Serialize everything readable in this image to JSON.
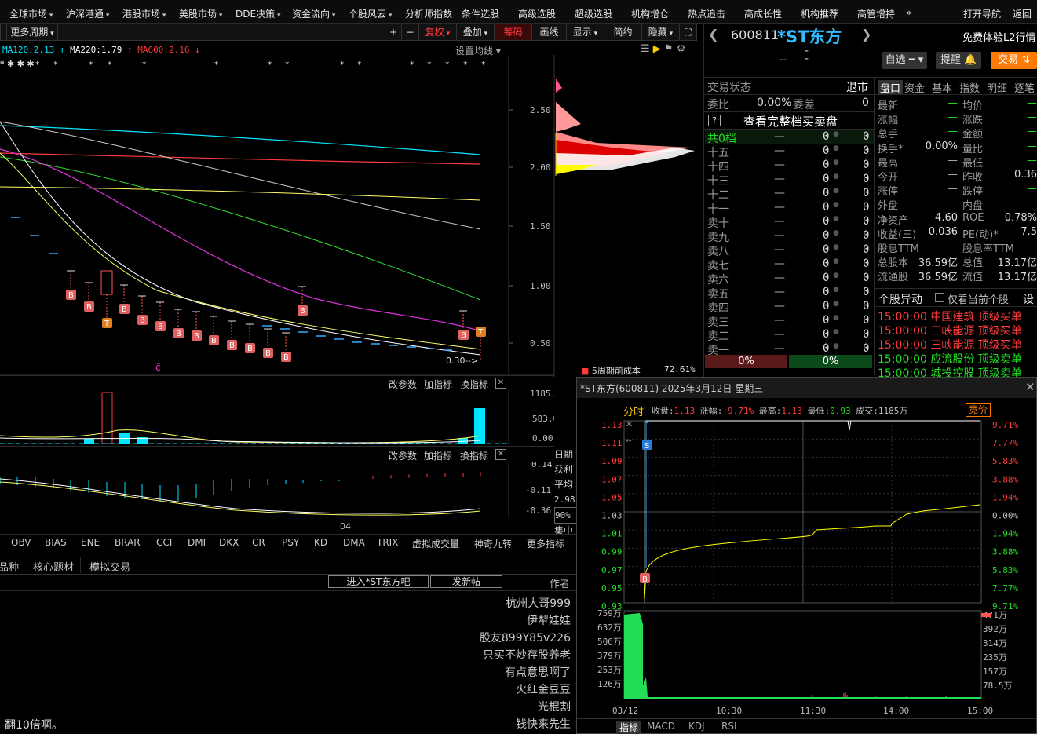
{
  "nav": [
    "全球市场",
    "沪深港通",
    "港股市场",
    "美股市场",
    "DDE决策",
    "资金流向",
    "个股风云",
    "分析师指数",
    "条件选股",
    "高级选股",
    "超级选股",
    "机构增仓",
    "热点追击",
    "高成长性",
    "机构推荐",
    "高管增持"
  ],
  "nav_more": "»",
  "nav_right": {
    "open_nav": "打开导航",
    "back": "返回"
  },
  "toolbar": {
    "period": "更多周期",
    "plus": "+",
    "minus": "−",
    "fuquan": "复权",
    "overlay": "叠加",
    "chips": "筹码",
    "draw": "画线",
    "display": "显示",
    "simple": "简约",
    "hide": "隐藏",
    "full": "⛶"
  },
  "ma": {
    "ma120": "MA120:2.13",
    "ma220": "MA220:1.79",
    "ma600": "MA600:2.16",
    "settings": "设置均线"
  },
  "price_axis": [
    "2.50",
    "2.00",
    "1.50",
    "1.00",
    "0.50"
  ],
  "last_price_label": "0.30",
  "vol_panel": {
    "change_params": "改参数",
    "add_ind": "加指标",
    "switch_ind": "换指标",
    "axis": [
      "1185.00",
      "583.00",
      "0.00"
    ]
  },
  "macd_panel": {
    "change_params": "改参数",
    "add_ind": "加指标",
    "switch_ind": "换指标",
    "axis": [
      "0.14",
      "-0.11",
      "-0.36"
    ]
  },
  "x_label": "04",
  "chip_panel": {
    "legend": "5周期前成本",
    "legend_value": "72.61%",
    "side": [
      "日期",
      "获利",
      "平均",
      "2.98",
      "90%",
      "集中"
    ]
  },
  "indicators": [
    "OBV",
    "BIAS",
    "ENE",
    "BRAR",
    "CCI",
    "DMI",
    "DKX",
    "CR",
    "PSY",
    "KD",
    "DMA",
    "TRIX",
    "虚拟成交量",
    "神奇九转",
    "更多指标"
  ],
  "bottom_tabs": [
    "品种",
    "核心题材",
    "模拟交易"
  ],
  "forum": {
    "enter": "进入*ST东方吧",
    "post": "发新帖",
    "author_header": "作者",
    "authors": [
      "杭州大哥999",
      "伊犁娃娃",
      "股友899Y85v226",
      "只买不炒存股养老",
      "有点意思啊了",
      "火红金豆豆",
      "光棍割",
      "钱快来先生"
    ],
    "last_post": "翻10倍啊。"
  },
  "stock": {
    "code": "600811",
    "name": "*ST东方",
    "l2": "免费体验L2行情",
    "dash1": "--",
    "dash2": "-",
    "self_select": "自选",
    "remind": "提醒",
    "trade": "交易"
  },
  "order_book": {
    "status_label": "交易状态",
    "status_value": "退市",
    "weibi_label": "委比",
    "weibi_value": "0.00%",
    "weicha_label": "委差",
    "weicha_value": "0",
    "full_book": "查看完整档买卖盘",
    "gong_label": "共0档",
    "dash": "—",
    "zero": "0",
    "levels": [
      "十五",
      "十四",
      "十三",
      "十二",
      "十一",
      "卖十",
      "卖九",
      "卖八",
      "卖七",
      "卖六",
      "卖五",
      "卖四",
      "卖三",
      "卖二",
      "卖一"
    ],
    "buy_pct": "0%",
    "sell_pct": "0%"
  },
  "quote_tabs": [
    "盘口",
    "资金",
    "基本",
    "指数",
    "明细",
    "逐笔"
  ],
  "quote": [
    {
      "l": "最新",
      "v": "—",
      "l2": "均价",
      "v2": "—"
    },
    {
      "l": "涨幅",
      "v": "—",
      "l2": "涨跌",
      "v2": "—"
    },
    {
      "l": "总手",
      "v": "—",
      "l2": "金额",
      "v2": "—"
    },
    {
      "l": "换手*",
      "v": "0.00%",
      "l2": "量比",
      "v2": "—"
    },
    {
      "l": "最高",
      "v": "—",
      "l2": "最低",
      "v2": "—"
    },
    {
      "l": "今开",
      "v": "—",
      "l2": "昨收",
      "v2": "0.36"
    },
    {
      "l": "涨停",
      "v": "—",
      "l2": "跌停",
      "v2": "—"
    },
    {
      "l": "外盘",
      "v": "—",
      "l2": "内盘",
      "v2": "—"
    },
    {
      "l": "净资产",
      "v": "4.60",
      "l2": "ROE",
      "v2": "0.78%"
    },
    {
      "l": "收益(三)",
      "v": "0.036",
      "l2": "PE(动)*",
      "v2": "7.5"
    },
    {
      "l": "股息TTM",
      "v": "—",
      "l2": "股息率TTM",
      "v2": "—"
    },
    {
      "l": "总股本",
      "v": "36.59亿",
      "l2": "总值",
      "v2": "13.17亿"
    },
    {
      "l": "流通股",
      "v": "36.59亿",
      "l2": "流值",
      "v2": "13.17亿"
    }
  ],
  "alerts": {
    "title": "个股异动",
    "only_current": "仅看当前个股",
    "settings": "设",
    "rows": [
      {
        "time": "15:00:00",
        "stock": "中国建筑",
        "type": "顶级买单",
        "color": "#ff3b3b"
      },
      {
        "time": "15:00:00",
        "stock": "三峡能源",
        "type": "顶级买单",
        "color": "#ff3b3b"
      },
      {
        "time": "15:00:00",
        "stock": "三峡能源",
        "type": "顶级买单",
        "color": "#ff3b3b"
      },
      {
        "time": "15:00:00",
        "stock": "应流股份",
        "type": "顶级卖单",
        "color": "#22dd22"
      },
      {
        "time": "15:00:00",
        "stock": "城投控股",
        "type": "顶级卖单",
        "color": "#22dd22"
      }
    ]
  },
  "popup": {
    "title": "*ST东方(600811) 2025年3月12日 星期三",
    "fenshi": "分时",
    "close_label": "收盘:",
    "close_value": "1.13",
    "chg_label": "涨幅:",
    "chg_value": "+9.71%",
    "high_label": "最高:",
    "high_value": "1.13",
    "low_label": "最低:",
    "low_value": "0.93",
    "vol_label": "成交:",
    "vol_value": "1185万",
    "auction": "竞价",
    "left_axis": [
      "1.13",
      "1.11",
      "1.09",
      "1.07",
      "1.05",
      "1.03",
      "1.01",
      "0.99",
      "0.97",
      "0.95",
      "0.93"
    ],
    "right_axis": [
      "9.71%",
      "7.77%",
      "5.83%",
      "3.88%",
      "1.94%",
      "0.00%",
      "1.94%",
      "3.88%",
      "5.83%",
      "7.77%",
      "9.71%"
    ],
    "vol_left": [
      "759万",
      "632万",
      "506万",
      "379万",
      "253万",
      "126万"
    ],
    "vol_right": [
      "471万",
      "392万",
      "314万",
      "235万",
      "157万",
      "78.5万"
    ],
    "times": [
      "03/12",
      "10:30",
      "11:30",
      "14:00",
      "15:00"
    ],
    "tabs": [
      "指标",
      "MACD",
      "KDJ",
      "RSI"
    ]
  },
  "colors": {
    "up": "#ff3b3b",
    "down": "#22dd22",
    "yellow": "#ffff00",
    "cyan": "#00e5ff",
    "accent": "#ff7a00",
    "blue": "#33aaff"
  }
}
